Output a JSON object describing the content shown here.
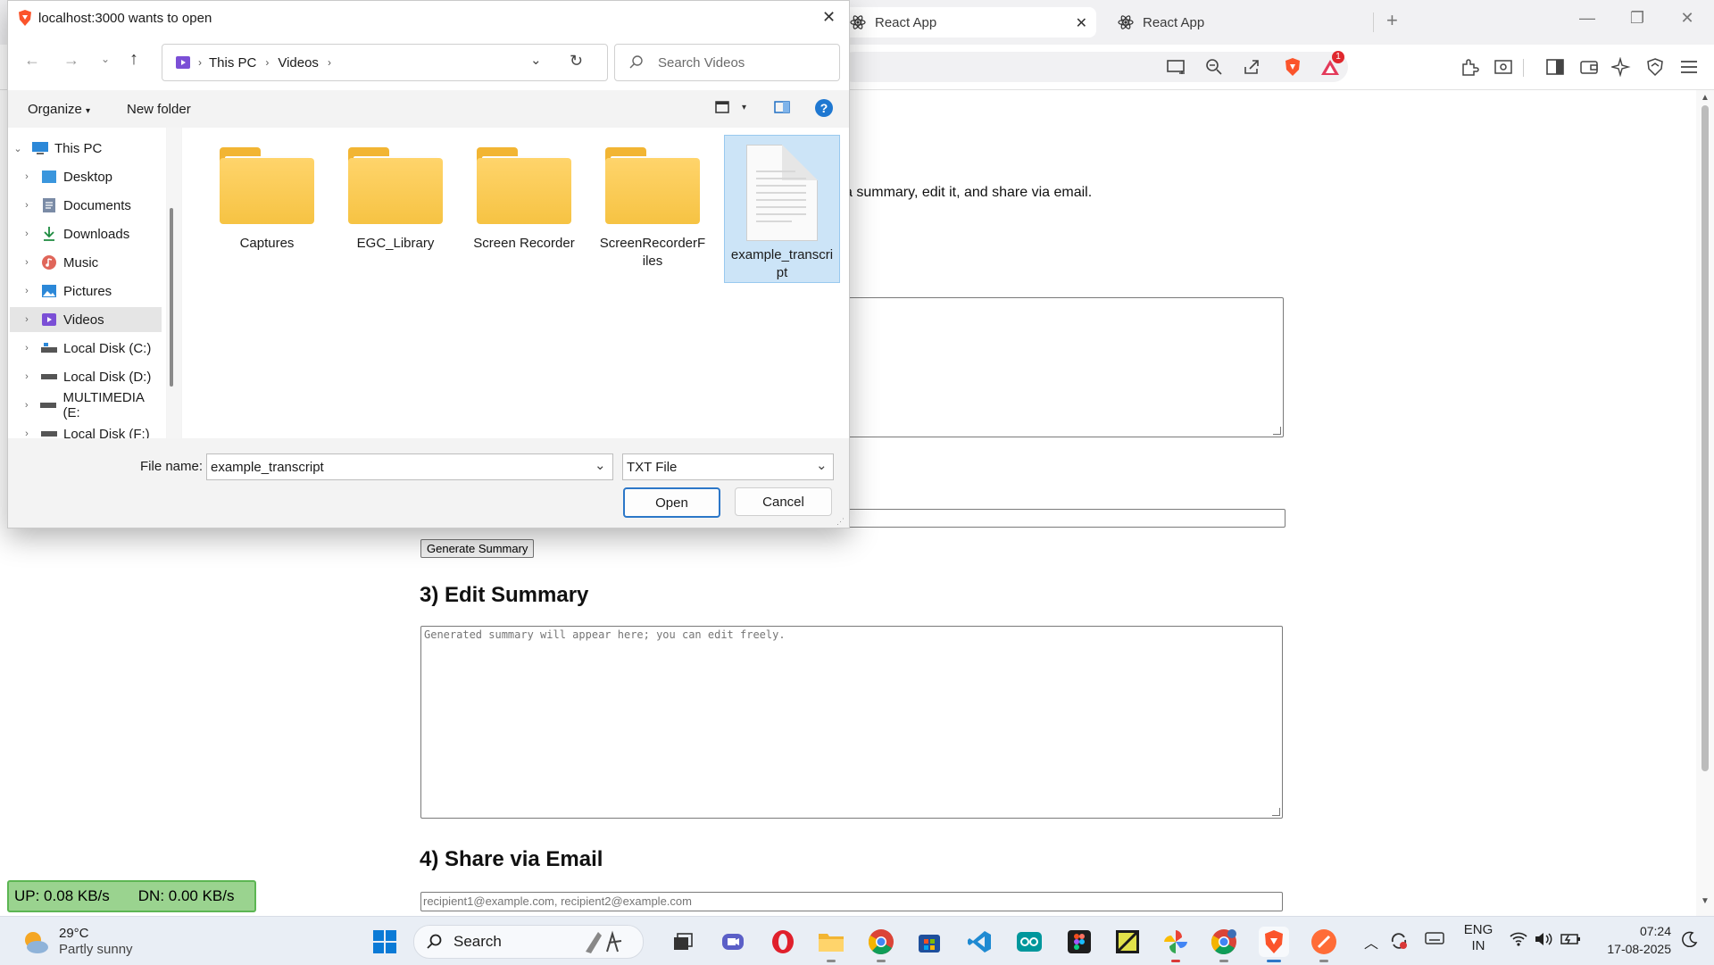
{
  "browser": {
    "tabs": [
      {
        "label": "React App",
        "active": true
      },
      {
        "label": "React App",
        "active": false
      }
    ],
    "new_tab": "+",
    "badge_count": "1"
  },
  "page": {
    "intro_fragment": "a summary, edit it, and share via email.",
    "generate_button": "Generate Summary",
    "edit_heading": "3) Edit Summary",
    "summary_placeholder": "Generated summary will appear here; you can edit freely.",
    "share_heading": "4) Share via Email",
    "email_placeholder": "recipient1@example.com, recipient2@example.com"
  },
  "dialog": {
    "title": "localhost:3000 wants to open",
    "breadcrumb": [
      "This PC",
      "Videos"
    ],
    "search_placeholder": "Search Videos",
    "organize": "Organize",
    "new_folder": "New folder",
    "help": "?",
    "nav_items": [
      {
        "label": "This PC",
        "icon": "pc-icon"
      },
      {
        "label": "Desktop",
        "icon": "desktop-icon"
      },
      {
        "label": "Documents",
        "icon": "documents-icon"
      },
      {
        "label": "Downloads",
        "icon": "downloads-icon"
      },
      {
        "label": "Music",
        "icon": "music-icon"
      },
      {
        "label": "Pictures",
        "icon": "pictures-icon"
      },
      {
        "label": "Videos",
        "icon": "videos-icon"
      },
      {
        "label": "Local Disk (C:)",
        "icon": "drive-icon"
      },
      {
        "label": "Local Disk (D:)",
        "icon": "drive-icon"
      },
      {
        "label": "MULTIMEDIA (E:",
        "icon": "drive-icon"
      },
      {
        "label": "Local Disk (F:)",
        "icon": "drive-icon"
      }
    ],
    "files": [
      {
        "name": "Captures",
        "type": "folder"
      },
      {
        "name": "EGC_Library",
        "type": "folder"
      },
      {
        "name": "Screen Recorder",
        "type": "folder"
      },
      {
        "name": "ScreenRecorderFiles",
        "type": "folder"
      },
      {
        "name": "example_transcript",
        "type": "txt"
      }
    ],
    "file_name_label": "File name:",
    "file_name_value": "example_transcript",
    "file_type": "TXT File",
    "open_button": "Open",
    "cancel_button": "Cancel"
  },
  "netmeter": {
    "up": "UP: 0.08 KB/s",
    "down": "DN: 0.00 KB/s"
  },
  "taskbar": {
    "weather_temp": "29°C",
    "weather_desc": "Partly sunny",
    "search_label": "Search",
    "lang_top": "ENG",
    "lang_bottom": "IN",
    "time": "07:24",
    "date": "17-08-2025"
  },
  "colors": {
    "accent": "#2c77c8",
    "selection": "#cce4f7",
    "folder": "#f6c343",
    "netmeter": "#9ad38f"
  }
}
